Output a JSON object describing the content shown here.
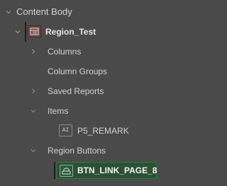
{
  "tree": {
    "root": {
      "label": "Content Body",
      "expanded": true
    },
    "region": {
      "label": "Region_Test",
      "expanded": true,
      "icon": "region-icon"
    },
    "children": [
      {
        "label": "Columns",
        "expanded": false
      },
      {
        "label": "Column Groups",
        "expanded": null
      },
      {
        "label": "Saved Reports",
        "expanded": false
      },
      {
        "label": "Items",
        "expanded": true
      }
    ],
    "item": {
      "label": "P5_REMARK",
      "icon": "item-icon",
      "icon_text": "AI"
    },
    "region_buttons": {
      "label": "Region Buttons",
      "expanded": true
    },
    "button": {
      "label": "BTN_LINK_PAGE_8",
      "icon": "button-icon",
      "selected": true
    }
  },
  "colors": {
    "background": "#4a4a4a",
    "text": "#d2d2d2",
    "selected_background": "#2b5134",
    "selected_border": "#2e7a3f"
  }
}
